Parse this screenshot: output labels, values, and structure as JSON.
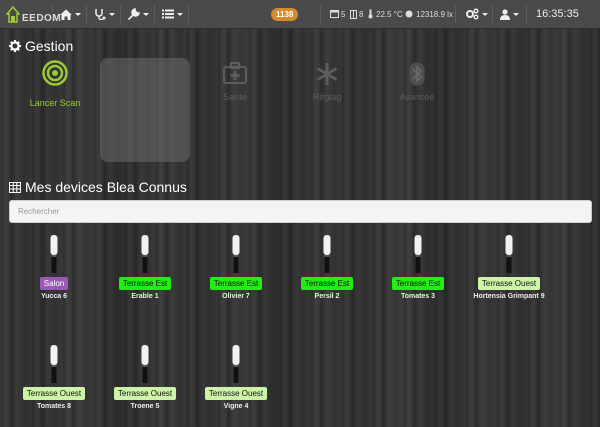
{
  "navbar": {
    "logo_text": "EEDOM",
    "badge_count": "1138",
    "temperature": "22.5 °C",
    "light": "12318.9 lx",
    "stat_a": "5",
    "stat_b": "8",
    "clock": "16:35:35"
  },
  "gestion": {
    "title": "Gestion",
    "scan_label": "Lancer Scan",
    "faded_items": [
      {
        "label": "Santé",
        "icon": "medkit-icon"
      },
      {
        "label": "Réglag",
        "icon": "asterisk-icon"
      },
      {
        "label": "Avancée",
        "icon": "bluetooth-icon"
      }
    ]
  },
  "devices_section": {
    "title": "Mes devices Blea Connus",
    "search_placeholder": "Rechercher"
  },
  "colors": {
    "salon": "#9b59b6",
    "terrasse_est": "#22ee11",
    "terrasse_ouest": "#ccf5a8",
    "accent": "#9ccc30"
  },
  "devices": [
    {
      "room": "Salon",
      "name": "Yucca 6"
    },
    {
      "room": "Terrasse Est",
      "name": "Erable 1"
    },
    {
      "room": "Terrasse Est",
      "name": "Olivier 7"
    },
    {
      "room": "Terrasse Est",
      "name": "Persil 2"
    },
    {
      "room": "Terrasse Est",
      "name": "Tomates 3"
    },
    {
      "room": "Terrasse Ouest",
      "name": "Hortensia Grimpant 9"
    },
    {
      "room": "Terrasse Ouest",
      "name": "Tomates 8"
    },
    {
      "room": "Terrasse Ouest",
      "name": "Troene 5"
    },
    {
      "room": "Terrasse Ouest",
      "name": "Vigne 4"
    }
  ]
}
